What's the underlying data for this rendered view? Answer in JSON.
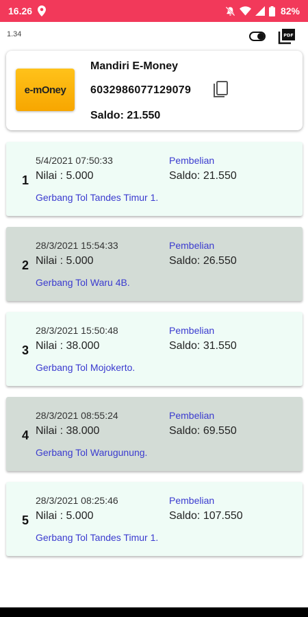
{
  "status_bar": {
    "time": "16.26",
    "battery": "82%",
    "icons": [
      "location-icon",
      "mute-icon",
      "wifi-icon",
      "signal-icon",
      "battery-icon"
    ]
  },
  "app_bar": {
    "version": "1.34",
    "icons": [
      "toggle-icon",
      "pdf-icon"
    ]
  },
  "card": {
    "logo_text": "e-mOney",
    "name": "Mandiri E-Money",
    "number": "6032986077129079",
    "balance": "Saldo: 21.550"
  },
  "transactions": [
    {
      "index": "1",
      "date": "5/4/2021 07:50:33",
      "type": "Pembelian",
      "amount": "Nilai : 5.000",
      "balance": "Saldo: 21.550",
      "gate": "Gerbang Tol Tandes Timur 1."
    },
    {
      "index": "2",
      "date": "28/3/2021 15:54:33",
      "type": "Pembelian",
      "amount": "Nilai : 5.000",
      "balance": "Saldo: 26.550",
      "gate": "Gerbang Tol Waru 4B."
    },
    {
      "index": "3",
      "date": "28/3/2021 15:50:48",
      "type": "Pembelian",
      "amount": "Nilai : 38.000",
      "balance": "Saldo: 31.550",
      "gate": "Gerbang Tol Mojokerto."
    },
    {
      "index": "4",
      "date": "28/3/2021 08:55:24",
      "type": "Pembelian",
      "amount": "Nilai : 38.000",
      "balance": "Saldo: 69.550",
      "gate": "Gerbang Tol Warugunung."
    },
    {
      "index": "5",
      "date": "28/3/2021 08:25:46",
      "type": "Pembelian",
      "amount": "Nilai : 5.000",
      "balance": "Saldo: 107.550",
      "gate": "Gerbang Tol Tandes Timur 1."
    }
  ],
  "colors": {
    "status_bar": "#f2395a",
    "row_light": "#effcf6",
    "row_dark": "#d3dcd6",
    "link_text": "#3a3acf"
  }
}
